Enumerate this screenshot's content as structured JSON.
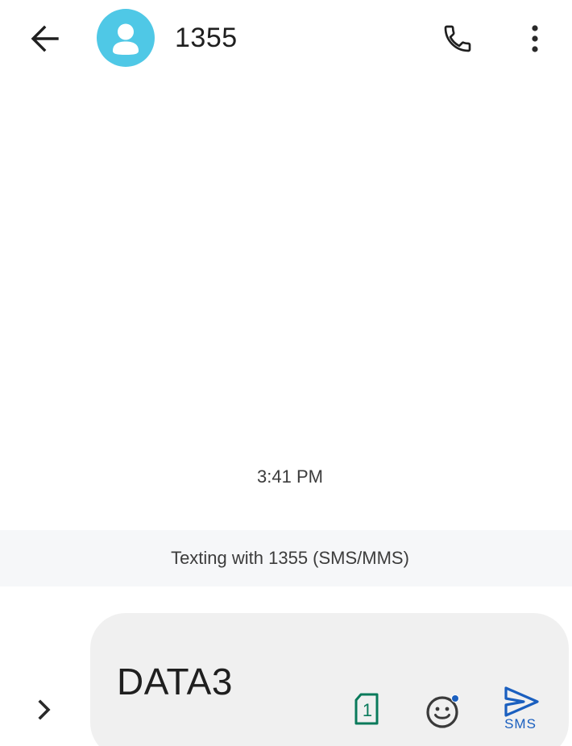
{
  "header": {
    "contact_name": "1355"
  },
  "conversation": {
    "timestamp": "3:41 PM",
    "info_banner": "Texting with 1355 (SMS/MMS)"
  },
  "compose": {
    "message_text": "DATA3",
    "sim_number": "1",
    "send_label": "SMS"
  },
  "icons": {
    "back": "arrow-back-icon",
    "avatar": "person-icon",
    "call": "phone-icon",
    "more": "more-vert-icon",
    "expand": "chevron-right-icon",
    "sim": "sim-card-icon",
    "emoji": "emoji-icon",
    "send": "send-icon"
  },
  "colors": {
    "avatar_bg": "#4fc8e6",
    "banner_bg": "#f6f7f9",
    "compose_bg": "#f0f0f0",
    "sim_green": "#0a7a5b",
    "send_blue": "#1a5fbf"
  }
}
